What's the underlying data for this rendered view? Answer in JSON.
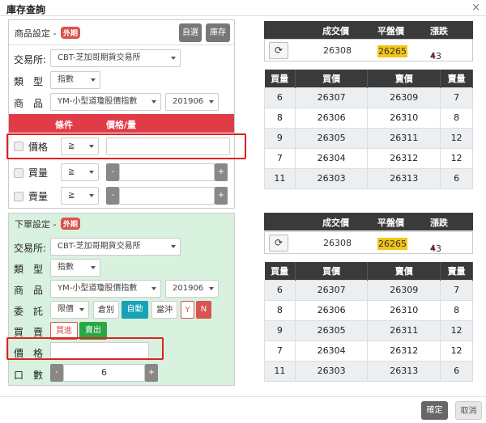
{
  "window": {
    "title": "庫存查詢",
    "close": "×"
  },
  "product": {
    "title": "商品設定 -",
    "badge": "外期",
    "btn_auto": "自選",
    "btn_inventory": "庫存",
    "exchange_label": "交易所",
    "exchange_value": "CBT-芝加哥期貨交易所",
    "type_label": "類　型",
    "type_value": "指數",
    "goods_label": "商　品",
    "goods_value": "YM-小型道瓊股價指數",
    "month_value": "201906"
  },
  "conditions": {
    "head_cond": "條件",
    "head_price": "價格/量",
    "rows": [
      {
        "label": "價格",
        "op": "≧",
        "value": ""
      },
      {
        "label": "買量",
        "op": "≧",
        "minus": "-",
        "plus": "+",
        "value": ""
      },
      {
        "label": "賣量",
        "op": "≧",
        "minus": "-",
        "plus": "+",
        "value": ""
      }
    ]
  },
  "order": {
    "title": "下單設定 -",
    "badge": "外期",
    "exchange_label": "交易所",
    "exchange_value": "CBT-芝加哥期貨交易所",
    "type_label": "類　型",
    "type_value": "指數",
    "goods_label": "商　品",
    "goods_value": "YM-小型道瓊股價指數",
    "month_value": "201906",
    "entrust_label": "委　託",
    "entrust_value": "限價",
    "btn_position": "倉別",
    "btn_auto": "自動",
    "btn_offset": "當沖",
    "btn_y": "Y",
    "btn_n": "N",
    "side_label": "買　賣",
    "btn_buy": "買進",
    "btn_sell": "賣出",
    "price_label": "價　格",
    "price_value": "",
    "qty_label": "口　數",
    "qty_minus": "-",
    "qty_value": "6",
    "qty_plus": "+"
  },
  "quote_headers": {
    "deal": "成交價",
    "flat": "平盤價",
    "change": "漲跌"
  },
  "book_headers": {
    "bid_qty": "買量",
    "bid": "買價",
    "ask": "賣價",
    "ask_qty": "賣量"
  },
  "quote1": {
    "deal": "26308",
    "flat": "26265",
    "change": "43"
  },
  "book1": [
    {
      "bid_qty": "6",
      "bid": "26307",
      "ask": "26309",
      "ask_qty": "7"
    },
    {
      "bid_qty": "8",
      "bid": "26306",
      "ask": "26310",
      "ask_qty": "8"
    },
    {
      "bid_qty": "9",
      "bid": "26305",
      "ask": "26311",
      "ask_qty": "12"
    },
    {
      "bid_qty": "7",
      "bid": "26304",
      "ask": "26312",
      "ask_qty": "12"
    },
    {
      "bid_qty": "11",
      "bid": "26303",
      "ask": "26313",
      "ask_qty": "6"
    }
  ],
  "quote2": {
    "deal": "26308",
    "flat": "26265",
    "change": "43"
  },
  "book2": [
    {
      "bid_qty": "6",
      "bid": "26307",
      "ask": "26309",
      "ask_qty": "7"
    },
    {
      "bid_qty": "8",
      "bid": "26306",
      "ask": "26310",
      "ask_qty": "8"
    },
    {
      "bid_qty": "9",
      "bid": "26305",
      "ask": "26311",
      "ask_qty": "12"
    },
    {
      "bid_qty": "7",
      "bid": "26304",
      "ask": "26312",
      "ask_qty": "12"
    },
    {
      "bid_qty": "11",
      "bid": "26303",
      "ask": "26313",
      "ask_qty": "6"
    }
  ],
  "footer": {
    "ok": "確定",
    "cancel": "取消"
  },
  "colors": {
    "accent_red": "#e03c48",
    "dark_header": "#3a3a3a",
    "highlight": "#f5c518",
    "buy_red": "#d9534f",
    "sell_green": "#28a745",
    "auto_teal": "#17a2b8",
    "order_panel_bg": "#d9f1df"
  }
}
